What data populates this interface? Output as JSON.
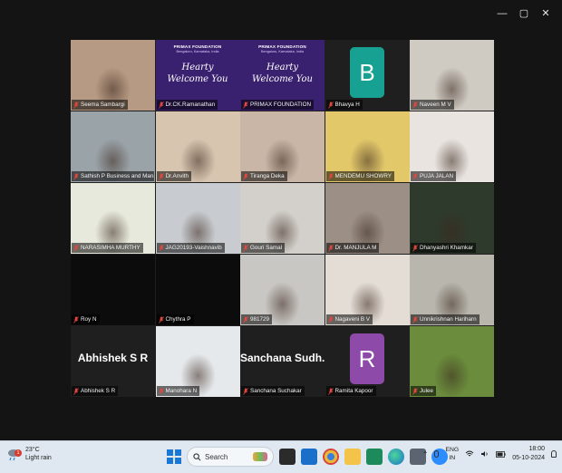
{
  "window": {
    "controls": [
      "—",
      "▢",
      "✕"
    ]
  },
  "participants": [
    {
      "name": "Seema Sambargi",
      "kind": "video",
      "bg": "#b79a83"
    },
    {
      "name": "Dr.CK.Ramanathan",
      "kind": "banner",
      "active": true
    },
    {
      "name": "PRIMAX FOUNDATION",
      "kind": "banner"
    },
    {
      "name": "Bhavya H",
      "kind": "letter",
      "letter": "B",
      "color": "#17a192"
    },
    {
      "name": "Naveen M V",
      "kind": "video",
      "bg": "#cfcac2"
    },
    {
      "name": "Sathish P Business and Manage",
      "kind": "video",
      "bg": "#9aa3a8"
    },
    {
      "name": "Dr.Anvith",
      "kind": "video",
      "bg": "#d7c5b0"
    },
    {
      "name": "Tiranga Deka",
      "kind": "video",
      "bg": "#c9b6a6"
    },
    {
      "name": "MENDEMU SHOWRY",
      "kind": "video",
      "bg": "#e3c86a"
    },
    {
      "name": "PUJA JALAN",
      "kind": "video",
      "bg": "#e9e4e0"
    },
    {
      "name": "NARASIMHA MURTHY",
      "kind": "video",
      "bg": "#e7e9dc"
    },
    {
      "name": "JAG20193-Vaishnavib",
      "kind": "video",
      "bg": "#c8ccd0"
    },
    {
      "name": "Gouri Samal",
      "kind": "video",
      "bg": "#d3d0cb"
    },
    {
      "name": "Dr. MANJULA M",
      "kind": "video",
      "bg": "#9b8f86"
    },
    {
      "name": "Dhanyashri Khamkar",
      "kind": "video",
      "bg": "#2e3a2c"
    },
    {
      "name": "Roy N",
      "kind": "dark"
    },
    {
      "name": "Chythra P",
      "kind": "dark"
    },
    {
      "name": "981729",
      "kind": "video",
      "bg": "#c9c7c4"
    },
    {
      "name": "Nagaveni B V",
      "kind": "video",
      "bg": "#e3ddd6"
    },
    {
      "name": "Unnikrishnan Hariharn",
      "kind": "video",
      "bg": "#b8b6ad"
    },
    {
      "name": "Abhishek S R",
      "kind": "text",
      "display": "Abhishek S R"
    },
    {
      "name": "Manohara N",
      "kind": "video",
      "bg": "#e6e9ec"
    },
    {
      "name": "Sanchana Suchakar",
      "kind": "text",
      "display": "Sanchana  Sudh..."
    },
    {
      "name": "Ramita Kapoor",
      "kind": "letter",
      "letter": "R",
      "color": "#8e4aa8"
    },
    {
      "name": "Julee",
      "kind": "video",
      "bg": "#6a8c3c"
    }
  ],
  "banner": {
    "org": "PRIMAX FOUNDATION",
    "place": "Bengaluru, Karnataka, India",
    "welcome_line1": "Hearty",
    "welcome_line2": "Welcome You"
  },
  "taskbar": {
    "weather_badge": "1",
    "temperature": "23°C",
    "condition": "Light rain",
    "search_label": "Search",
    "language_line1": "ENG",
    "language_line2": "IN",
    "time": "18:00",
    "date": "05-10-2024"
  },
  "colors": {
    "active_border": "#3cc47c",
    "mute_icon": "#e0483f",
    "banner": "#3a2170"
  }
}
